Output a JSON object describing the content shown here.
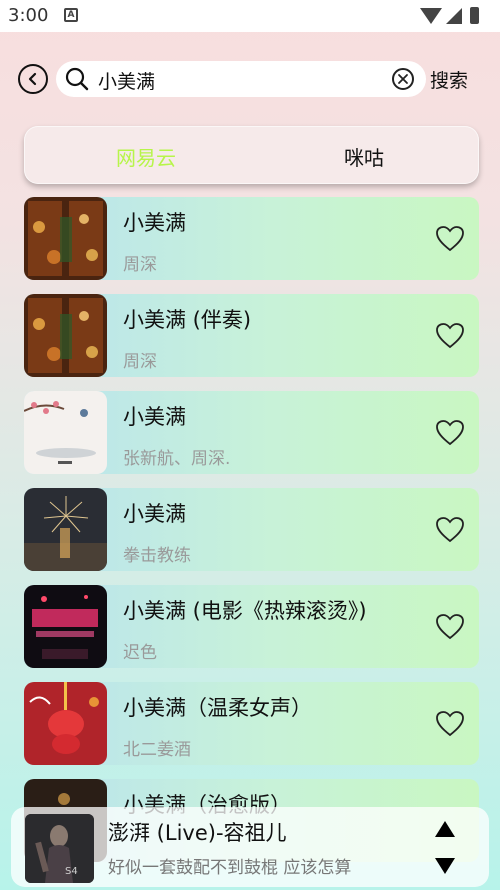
{
  "status_bar": {
    "time": "3:00",
    "notif_letter": "A"
  },
  "search": {
    "query": "小美满",
    "button_label": "搜索"
  },
  "tabs": [
    {
      "label": "网易云",
      "active": true
    },
    {
      "label": "咪咕",
      "active": false
    }
  ],
  "colors": {
    "active_tab": "#b7f54a",
    "row_start": "#b9e3ef",
    "row_end": "#c9f7c2"
  },
  "songs": [
    {
      "title": "小美满",
      "artist": "周深",
      "cover": "warm-bokeh-cover"
    },
    {
      "title": "小美满 (伴奏)",
      "artist": "周深",
      "cover": "warm-bokeh-cover"
    },
    {
      "title": "小美满",
      "artist": "张新航、周深.",
      "cover": "plum-blossom-cover"
    },
    {
      "title": "小美满",
      "artist": "拳击教练",
      "cover": "fireworks-cover"
    },
    {
      "title": "小美满 (电影《热辣滚烫》)",
      "artist": "迟色",
      "cover": "neon-cover"
    },
    {
      "title": "小美满（温柔女声）",
      "artist": "北二姜酒",
      "cover": "red-lantern-cover"
    },
    {
      "title": "小美满（治愈版）",
      "artist": "",
      "cover": "dark-cover"
    }
  ],
  "player": {
    "title": "澎湃 (Live)-容祖儿",
    "lyric": "好似一套鼓配不到鼓棍 应该怎算"
  }
}
